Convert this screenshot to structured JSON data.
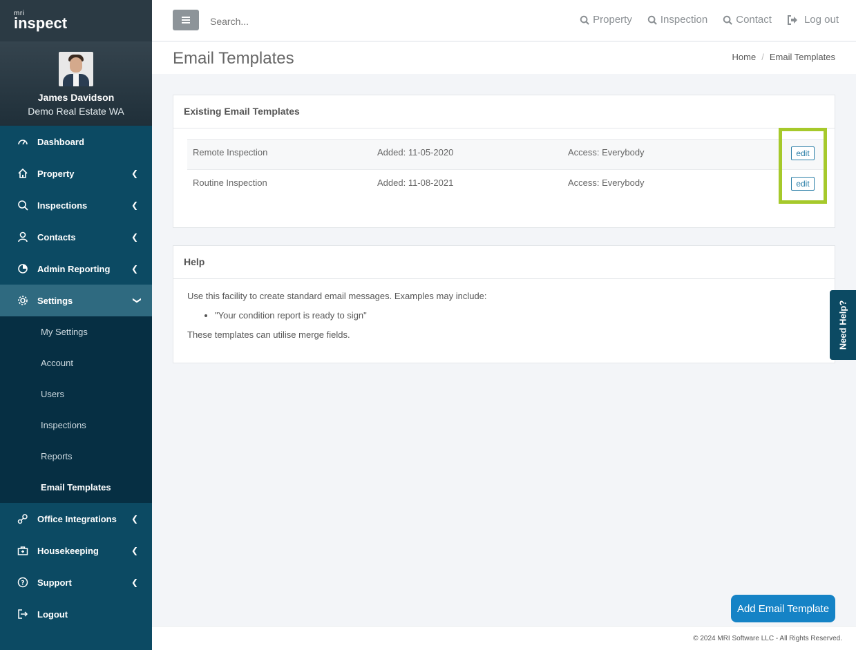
{
  "brand": {
    "mri": "mri",
    "name": "inspect"
  },
  "profile": {
    "name": "James Davidson",
    "org": "Demo Real Estate WA"
  },
  "nav": [
    {
      "label": "Dashboard",
      "icon": "speedometer-icon"
    },
    {
      "label": "Property",
      "icon": "home-icon"
    },
    {
      "label": "Inspections",
      "icon": "search-icon"
    },
    {
      "label": "Contacts",
      "icon": "user-icon"
    },
    {
      "label": "Admin Reporting",
      "icon": "pie-chart-icon"
    },
    {
      "label": "Settings",
      "icon": "gear-icon"
    },
    {
      "label": "Office Integrations",
      "icon": "integration-icon"
    },
    {
      "label": "Housekeeping",
      "icon": "toolbox-icon"
    },
    {
      "label": "Support",
      "icon": "question-icon"
    },
    {
      "label": "Logout",
      "icon": "logout-icon"
    }
  ],
  "settings_sub": [
    "My Settings",
    "Account",
    "Users",
    "Inspections",
    "Reports",
    "Email Templates"
  ],
  "search": {
    "placeholder": "Search..."
  },
  "top_links": [
    "Property",
    "Inspection",
    "Contact",
    "Log out"
  ],
  "page": {
    "title": "Email Templates",
    "breadcrumb_home": "Home",
    "breadcrumb_current": "Email Templates"
  },
  "templates_card": {
    "title": "Existing Email Templates",
    "rows": [
      {
        "name": "Remote Inspection",
        "added": "Added: 11-05-2020",
        "access": "Access: Everybody",
        "edit": "edit"
      },
      {
        "name": "Routine Inspection",
        "added": "Added: 11-08-2021",
        "access": "Access: Everybody",
        "edit": "edit"
      }
    ]
  },
  "help_card": {
    "title": "Help",
    "intro": "Use this facility to create standard email messages. Examples may include:",
    "example": "\"Your condition report is ready to sign\"",
    "outro": "These templates can utilise merge fields."
  },
  "need_help": "Need Help?",
  "add_button": "Add Email Template",
  "footer": "© 2024 MRI Software LLC - All Rights Reserved.",
  "colors": {
    "sidebar": "#0c4a63",
    "accent": "#1583c6",
    "highlight": "#a6c92b"
  }
}
